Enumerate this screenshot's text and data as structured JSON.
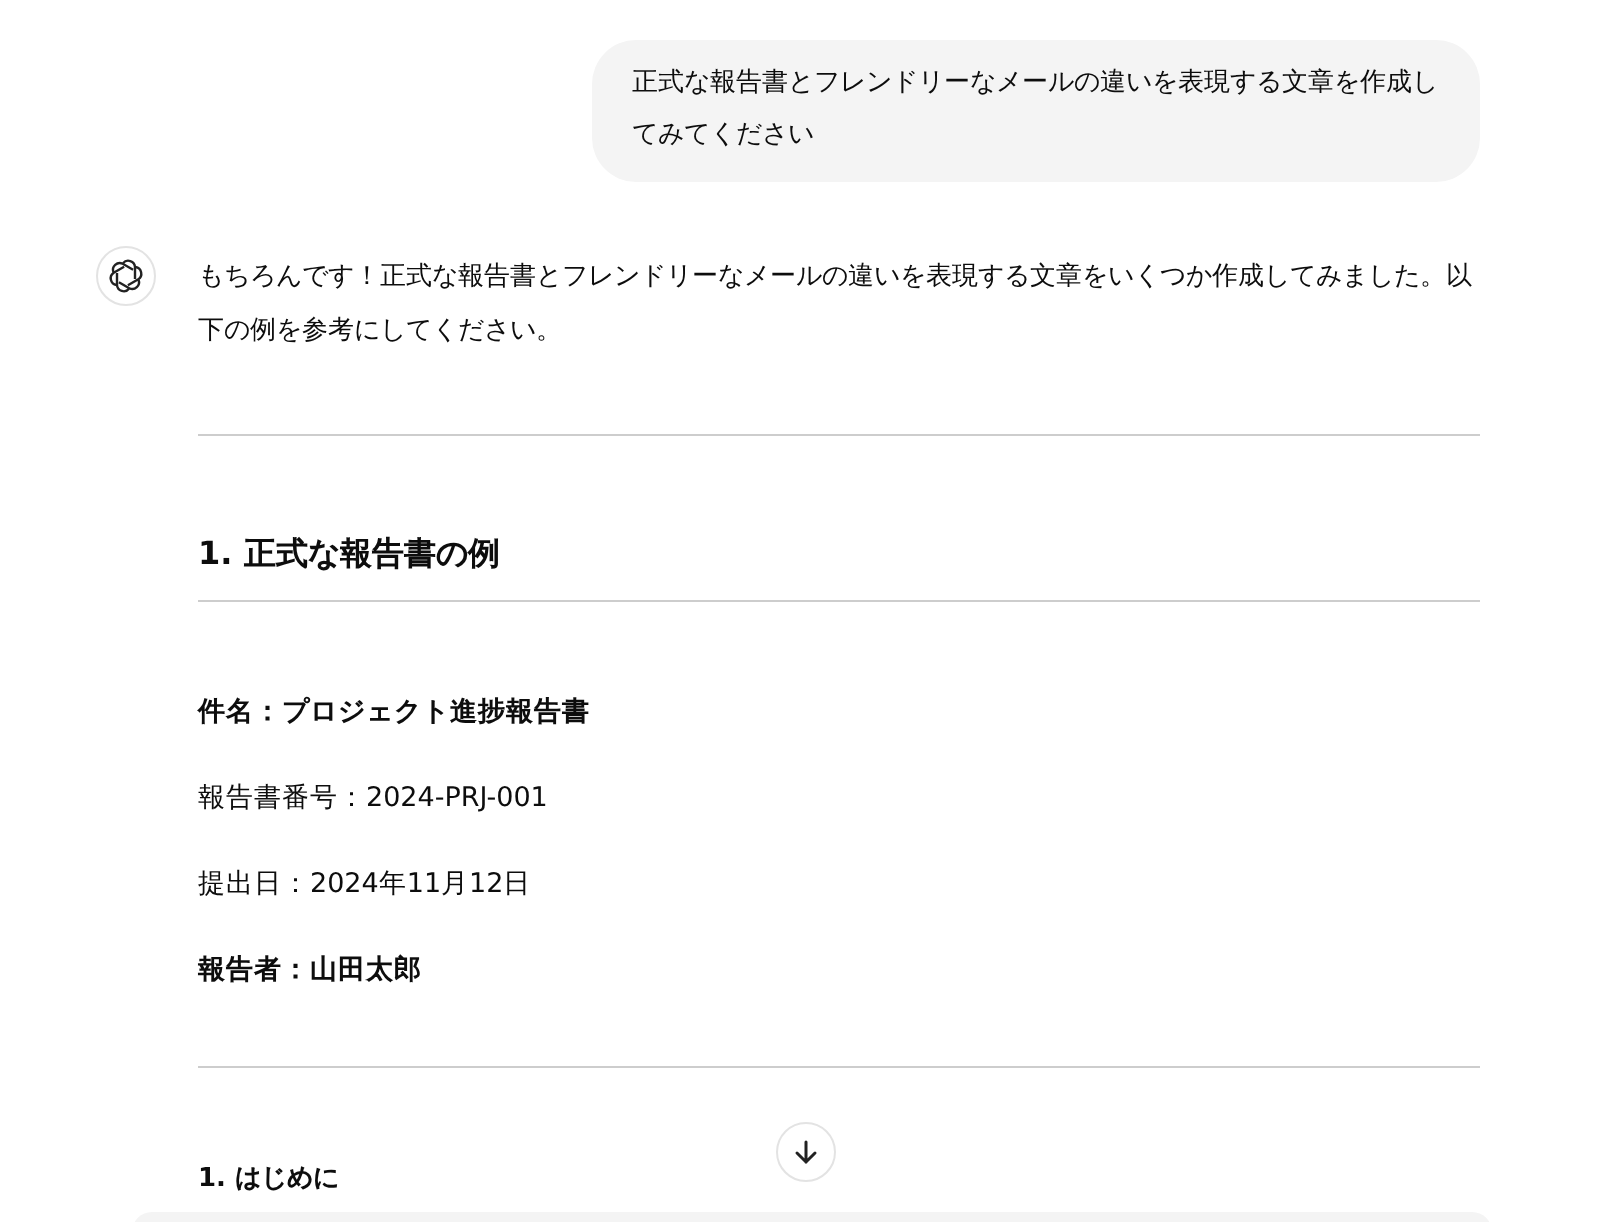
{
  "user_message": {
    "text": "正式な報告書とフレンドリーなメールの違いを表現する文章を作成してみてください"
  },
  "assistant_message": {
    "intro": "もちろんです！正式な報告書とフレンドリーなメールの違いを表現する文章をいくつか作成してみました。以下の例を参考にしてください。",
    "section_heading": "1. 正式な報告書の例",
    "fields": [
      {
        "text": "件名：プロジェクト進捗報告書",
        "bold": true
      },
      {
        "text": "報告書番号：2024-PRJ-001",
        "bold": false
      },
      {
        "text": "提出日：2024年11月12日",
        "bold": false
      },
      {
        "text": "報告者：山田太郎",
        "bold": true
      }
    ],
    "subheading": "1. はじめに"
  }
}
